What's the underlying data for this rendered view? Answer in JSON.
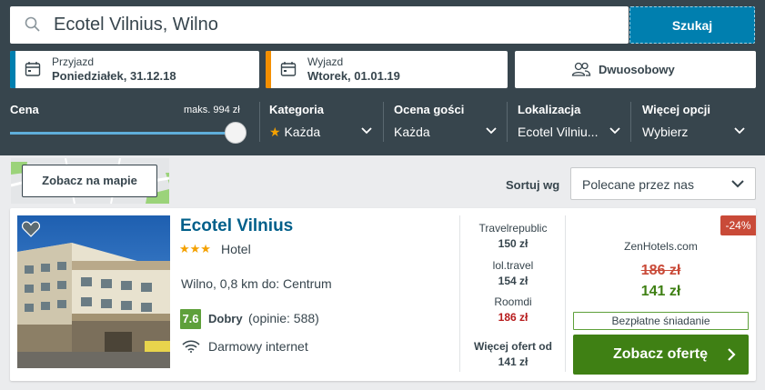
{
  "search": {
    "query": "Ecotel Vilnius, Wilno",
    "button_label": "Szukaj"
  },
  "dates": {
    "checkin": {
      "label": "Przyjazd",
      "value": "Poniedziałek, 31.12.18"
    },
    "checkout": {
      "label": "Wyjazd",
      "value": "Wtorek, 01.01.19"
    }
  },
  "guests": {
    "value": "Dwuosobowy"
  },
  "filters": {
    "price": {
      "title": "Cena",
      "max_label": "maks. 994 zł",
      "level_fraction": 1.0
    },
    "category": {
      "title": "Kategoria",
      "value": "Każda"
    },
    "rating": {
      "title": "Ocena gości",
      "value": "Każda"
    },
    "location": {
      "title": "Lokalizacja",
      "value": "Ecotel Vilniu..."
    },
    "more": {
      "title": "Więcej opcji",
      "value": "Wybierz"
    }
  },
  "map": {
    "button_label": "Zobacz na mapie"
  },
  "sort": {
    "label": "Sortuj wg",
    "value": "Polecane przez nas"
  },
  "hotel": {
    "name": "Ecotel Vilnius",
    "stars": "★★★",
    "type": "Hotel",
    "location": "Wilno, 0,8 km do: Centrum",
    "rating_score": "7.6",
    "rating_word": "Dobry",
    "rating_count": "(opinie: 588)",
    "amenity": "Darmowy internet"
  },
  "deals": [
    {
      "site": "Travelrepublic",
      "price": "150 zł",
      "highlight": false
    },
    {
      "site": "lol.travel",
      "price": "154 zł",
      "highlight": false
    },
    {
      "site": "Roomdi",
      "price": "186 zł",
      "highlight": true
    }
  ],
  "more_offers": {
    "label": "Więcej ofert od",
    "price": "141 zł"
  },
  "best_offer": {
    "discount": "-24%",
    "site": "ZenHotels.com",
    "old_price": "186 zł",
    "price": "141 zł",
    "perk": "Bezpłatne śniadanie",
    "cta_label": "Zobacz ofertę"
  },
  "colors": {
    "panel": "#37454d",
    "accent_blue": "#007faf",
    "accent_orange": "#f48f00",
    "cta_green": "#3f8014",
    "rating_green": "#5ea03a",
    "discount_red": "#c94a38"
  }
}
